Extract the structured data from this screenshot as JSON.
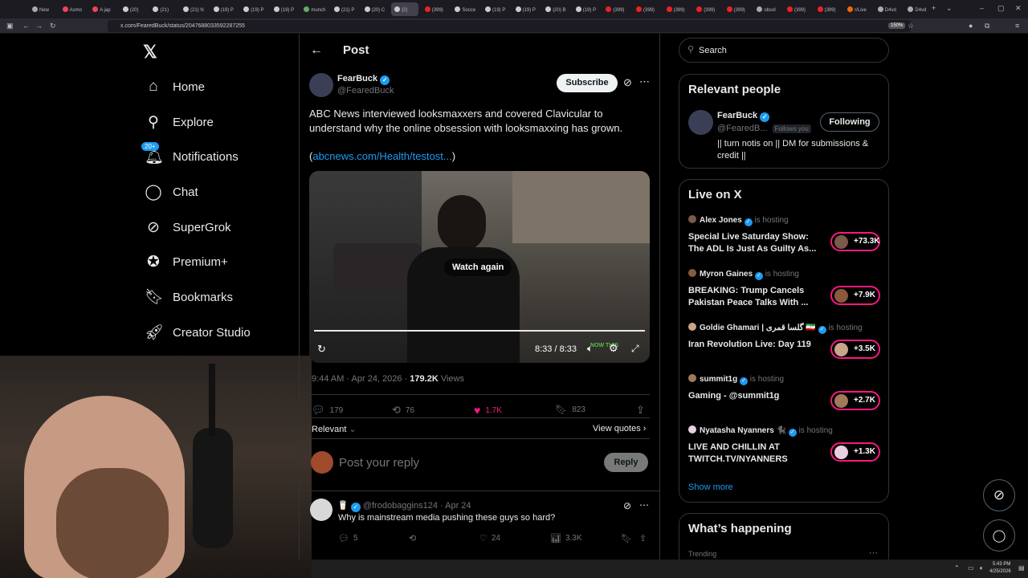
{
  "browser": {
    "tabs": [
      "New",
      "Asmo",
      "A jap",
      "(20)",
      "(21)",
      "(21) N",
      "(19) P",
      "(19) P",
      "(19) P",
      "munch",
      "(21) P",
      "(20) C",
      "(2)",
      "(399)",
      "Socce",
      "(19) P",
      "(19) P",
      "(20) B",
      "(19) P",
      "(399)",
      "(399)",
      "(399)",
      "(399)",
      "(399)",
      "obsol",
      "(399)",
      "(399)",
      "r/Live",
      "D4vd",
      "D4vd"
    ],
    "url": "x.com/FearedBuck/status/2047688033592287255",
    "zoom": "150%"
  },
  "nav": {
    "items": [
      {
        "label": "Home",
        "icon": "home-icon"
      },
      {
        "label": "Explore",
        "icon": "search-icon"
      },
      {
        "label": "Notifications",
        "icon": "bell-icon",
        "badge": "20+"
      },
      {
        "label": "Chat",
        "icon": "chat-icon"
      },
      {
        "label": "SuperGrok",
        "icon": "grok-icon"
      },
      {
        "label": "Premium+",
        "icon": "premium-icon"
      },
      {
        "label": "Bookmarks",
        "icon": "bookmark-icon"
      },
      {
        "label": "Creator Studio",
        "icon": "rocket-icon"
      }
    ]
  },
  "post": {
    "header_title": "Post",
    "author_name": "FearBuck",
    "author_handle": "@FearedBuck",
    "subscribe_label": "Subscribe",
    "text": "ABC News interviewed looksmaxxers and covered Clavicular to understand why the online obsession with looksmaxxing has grown.",
    "link_open": "(",
    "link_text": "abcnews.com/Health/testost...",
    "link_close": ")",
    "video": {
      "overlay_label": "Watch again",
      "time": "8:33 / 8:33",
      "watermark": "NOW THIS"
    },
    "timestamp": "9:44 AM · Apr 24, 2026 · ",
    "views_count": "179.2K",
    "views_label": " Views",
    "stats": {
      "replies": "179",
      "reposts": "76",
      "likes": "1.7K",
      "bookmarks": "823"
    },
    "sort_label": "Relevant",
    "view_quotes": "View quotes",
    "reply_placeholder": "Post your reply",
    "reply_button": "Reply"
  },
  "reply": {
    "handle": "@frodobaggins124",
    "date": "· Apr 24",
    "text": "Why is mainstream media pushing these guys so hard?",
    "stats": {
      "replies": "5",
      "likes": "24",
      "views": "3.3K"
    }
  },
  "search": {
    "placeholder": "Search"
  },
  "relevant_people": {
    "title": "Relevant people",
    "name": "FearBuck",
    "handle": "@FearedB...",
    "follows_you": "Follows you",
    "follow_label": "Following",
    "bio": "|| turn notis on || DM for submissions & credit ||"
  },
  "live": {
    "title": "Live on X",
    "hosting": "is hosting",
    "items": [
      {
        "host": "Alex Jones",
        "title": "Special Live Saturday Show: The ADL Is Just As Guilty As...",
        "count": "+73.3K"
      },
      {
        "host": "Myron Gaines",
        "title": "BREAKING: Trump Cancels Pakistan Peace Talks With ...",
        "count": "+7.9K"
      },
      {
        "host": "Goldie Ghamari | گلسا قمری 🇮🇷",
        "title": "Iran Revolution Live: Day 119",
        "count": "+3.5K"
      },
      {
        "host": "summit1g",
        "title": "Gaming - @summit1g",
        "count": "+2.7K"
      },
      {
        "host": "Nyatasha Nyanners 🐈‍⬛",
        "title": "LIVE AND CHILLIN AT TWITCH.TV/NYANNERS",
        "count": "+1.3K"
      }
    ],
    "show_more": "Show more"
  },
  "whats_happening": {
    "title": "What’s happening",
    "trending": "Trending"
  },
  "taskbar": {
    "time": "5:43 PM",
    "date": "4/25/2026"
  },
  "colors": {
    "accent": "#1d9bf0",
    "like": "#f91880",
    "bg": "#000000",
    "border": "#2f3336"
  }
}
